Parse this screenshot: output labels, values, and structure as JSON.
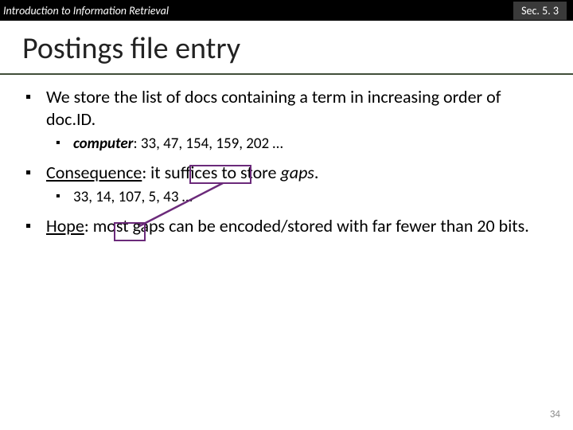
{
  "topbar": {
    "left": "Introduction to Information Retrieval",
    "right": "Sec. 5. 3"
  },
  "title": "Postings file entry",
  "bullets": {
    "b1": "We store the list of docs containing a term in increasing order of doc.ID.",
    "b1a_term": "computer",
    "b1a_rest": ": 33, 47, 154, 159, 202 …",
    "b2_label": "Consequence",
    "b2_rest": ": it suffices to store ",
    "b2_it": "gaps",
    "b2_end": ".",
    "b2a": "33, 14, 107, 5, 43 …",
    "b3_label": "Hope",
    "b3_rest": ": most gaps can be encoded/stored with far fewer than 20 bits."
  },
  "pagenum": "34"
}
